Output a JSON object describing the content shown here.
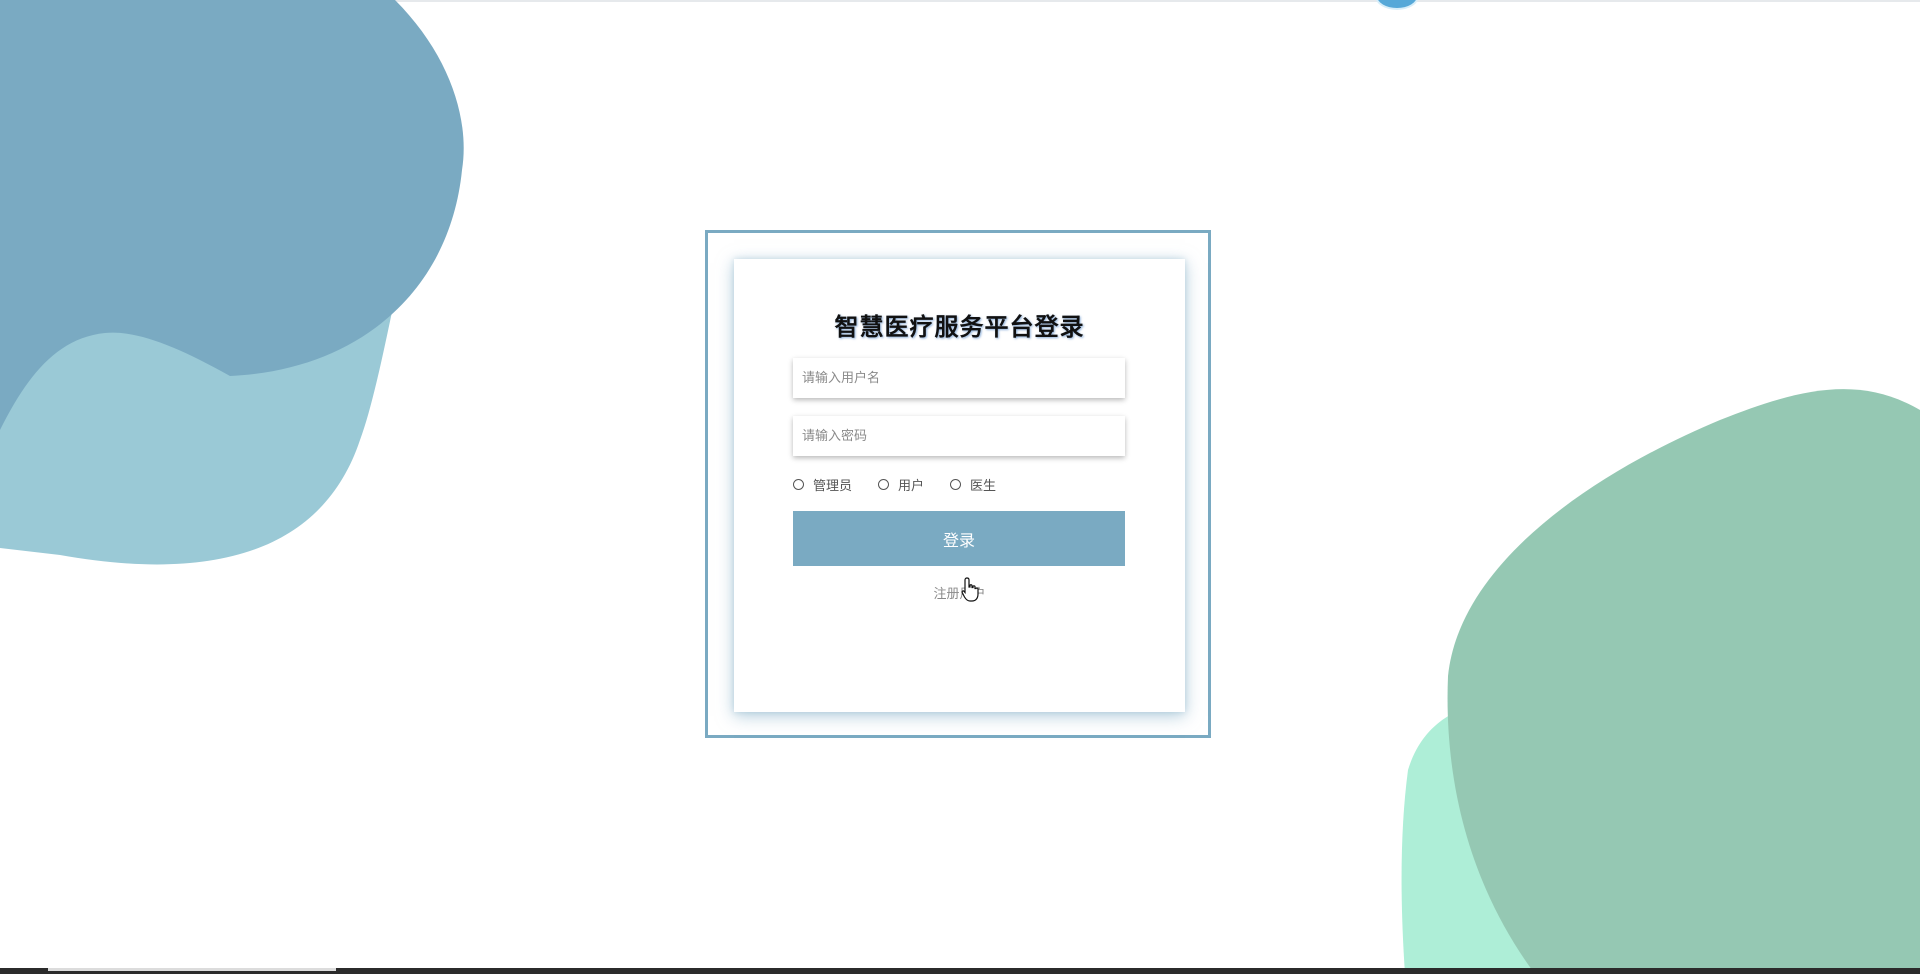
{
  "login": {
    "title": "智慧医疗服务平台登录",
    "username_placeholder": "请输入用户名",
    "password_placeholder": "请输入密码",
    "roles": [
      "管理员",
      "用户",
      "医生"
    ],
    "login_button": "登录",
    "register_link": "注册用户"
  },
  "colors": {
    "accent": "#7aaac2",
    "blob_blue_dark": "#7aaac2",
    "blob_blue_light": "#9ac9d6",
    "blob_green_dark": "#95c8b3",
    "blob_green_light": "#aeeed7"
  },
  "icons": {
    "cursor": "hand-pointer-icon"
  }
}
